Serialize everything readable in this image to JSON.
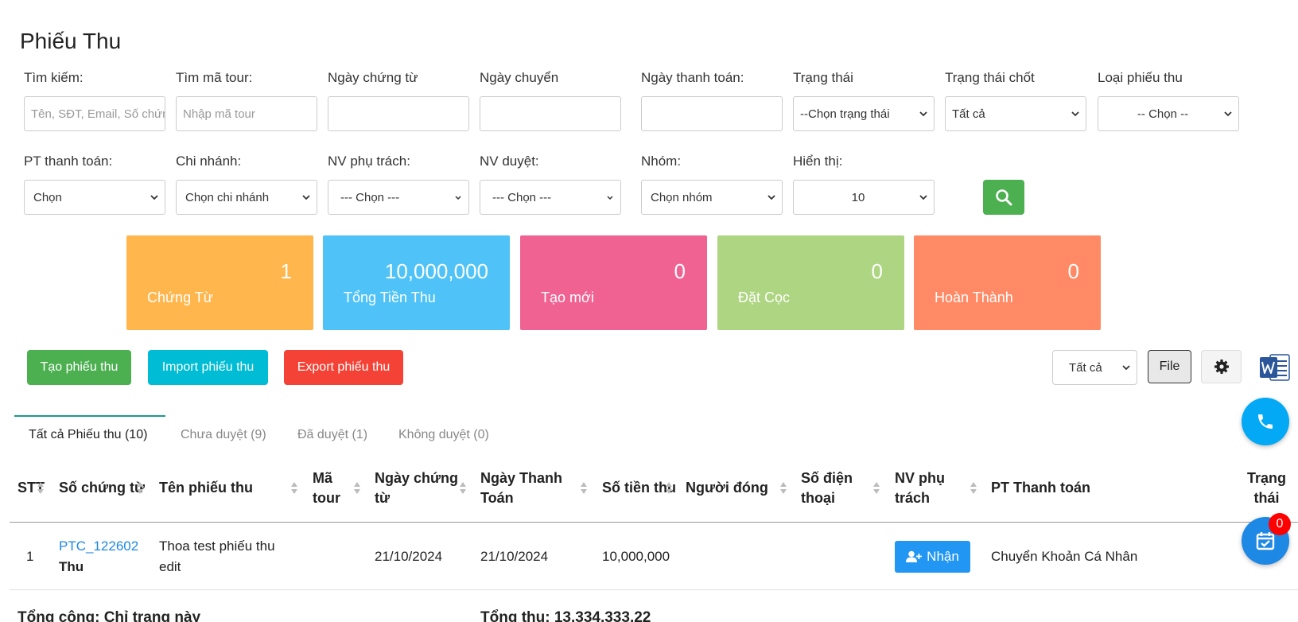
{
  "page": {
    "title": "Phiếu Thu"
  },
  "filters": {
    "search": {
      "label": "Tìm kiếm:",
      "placeholder": "Tên, SĐT, Email, Số chứng từ"
    },
    "tour_code": {
      "label": "Tìm mã tour:",
      "placeholder": "Nhập mã tour"
    },
    "doc_date": {
      "label": "Ngày chứng từ",
      "value": ""
    },
    "transfer_date": {
      "label": "Ngày chuyển",
      "value": ""
    },
    "payment_date": {
      "label": "Ngày thanh toán:",
      "value": ""
    },
    "status": {
      "label": "Trạng thái",
      "value": "--Chọn trạng thái"
    },
    "lock_status": {
      "label": "Trạng thái chốt",
      "value": "Tất cả"
    },
    "receipt_type": {
      "label": "Loại phiếu thu",
      "value": "-- Chọn --"
    },
    "payment_method": {
      "label": "PT thanh toán:",
      "value": "Chọn"
    },
    "branch": {
      "label": "Chi nhánh:",
      "value": "Chọn chi nhánh"
    },
    "staff": {
      "label": "NV phụ trách:",
      "value": "--- Chọn ---"
    },
    "approver": {
      "label": "NV duyệt:",
      "value": "--- Chọn ---"
    },
    "group": {
      "label": "Nhóm:",
      "value": "Chọn nhóm"
    },
    "display": {
      "label": "Hiển thị:",
      "value": "10"
    }
  },
  "stats": [
    {
      "value": "1",
      "label": "Chứng Từ",
      "color": "#ffb74d"
    },
    {
      "value": "10,000,000",
      "label": "Tổng Tiền Thu",
      "color": "#4fc3f7"
    },
    {
      "value": "0",
      "label": "Tạo mới",
      "color": "#f06292"
    },
    {
      "value": "0",
      "label": "Đặt Cọc",
      "color": "#aed581"
    },
    {
      "value": "0",
      "label": "Hoàn Thành",
      "color": "#ff8a65"
    }
  ],
  "actions": {
    "create": "Tạo phiếu thu",
    "import": "Import phiếu thu",
    "export": "Export phiếu thu",
    "filter_all": "Tất cả",
    "file": "File"
  },
  "tabs": [
    {
      "label": "Tất cả Phiếu thu (10)"
    },
    {
      "label": "Chưa duyệt (9)"
    },
    {
      "label": "Đã duyệt (1)"
    },
    {
      "label": "Không duyệt (0)"
    }
  ],
  "table": {
    "headers": {
      "stt": "STT",
      "doc_no": "Số chứng từ",
      "name": "Tên phiếu thu",
      "tour_l1": "Mã",
      "tour_l2": "tour",
      "doc_date_l1": "Ngày chứng",
      "doc_date_l2": "từ",
      "pay_date_l1": "Ngày Thanh",
      "pay_date_l2": "Toán",
      "amount": "Số tiền thu",
      "payer": "Người đóng",
      "phone_l1": "Số điện",
      "phone_l2": "thoại",
      "staff_l1": "NV phụ",
      "staff_l2": "trách",
      "method": "PT Thanh toán",
      "status_l1": "Trạng",
      "status_l2": "thái"
    },
    "rows": [
      {
        "stt": "1",
        "doc_no": "PTC_122602",
        "doc_type": "Thu",
        "name_l1": "Thoa test phiếu thu",
        "name_l2": "edit",
        "doc_date": "21/10/2024",
        "pay_date": "21/10/2024",
        "amount": "10,000,000",
        "staff_button": "Nhận",
        "method": "Chuyển Khoản Cá Nhân"
      }
    ],
    "footer_left": "Tổng cộng: Chỉ trang này",
    "footer_total": "Tổng thu: 13,334,333.22"
  },
  "notifications": {
    "count": "0"
  }
}
